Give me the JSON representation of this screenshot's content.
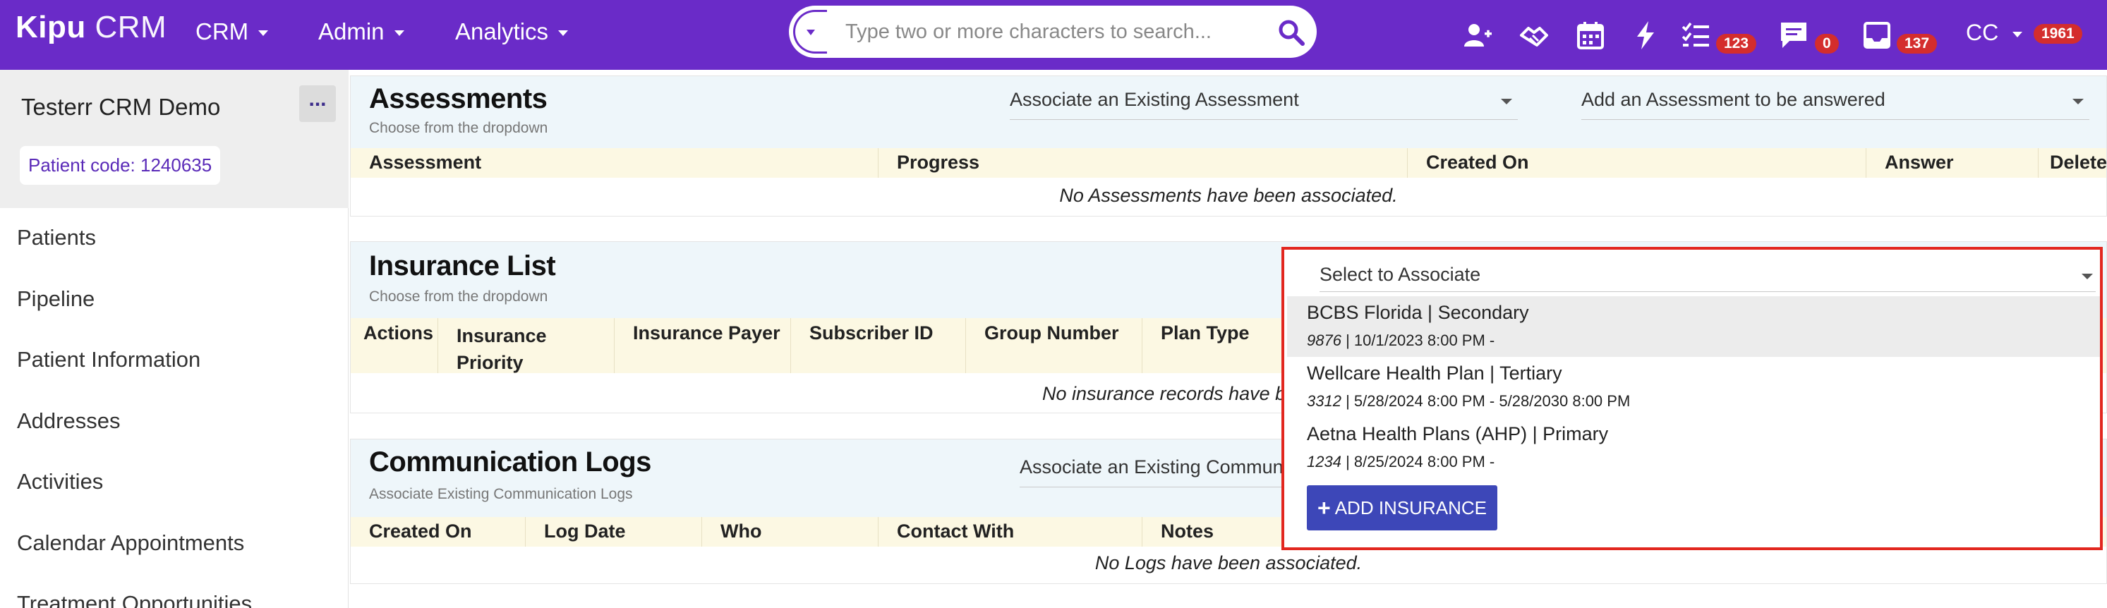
{
  "topbar": {
    "logo_bold": "Kipu",
    "logo_light": "CRM",
    "nav": [
      "CRM",
      "Admin",
      "Analytics"
    ],
    "search_placeholder": "Type two or more characters to search...",
    "icons": [
      "add-user-icon",
      "handshake-icon",
      "calendar-icon",
      "lightning-icon",
      "checklist-icon",
      "chat-icon",
      "inbox-icon"
    ],
    "badges": {
      "tasks": "123",
      "messages": "0",
      "inbox": "137",
      "user": "1961"
    },
    "user_initials": "CC",
    "colors": {
      "topbar": "#6a2bc8",
      "badge": "#d42d2d"
    }
  },
  "sidebar": {
    "title": "Testerr CRM Demo",
    "menu_dots": "...",
    "patient_code": "Patient code: 1240635",
    "items": [
      "Patients",
      "Pipeline",
      "Patient Information",
      "Addresses",
      "Activities",
      "Calendar Appointments",
      "Treatment Opportunities"
    ]
  },
  "assessments": {
    "title": "Assessments",
    "subtitle": "Choose from the dropdown",
    "select_existing": "Associate an Existing Assessment",
    "select_add": "Add an Assessment to be answered",
    "columns": [
      "Assessment",
      "Progress",
      "Created On",
      "Answer",
      "Delete"
    ],
    "empty": "No Assessments have been associated."
  },
  "insurance": {
    "title": "Insurance List",
    "subtitle": "Choose from the dropdown",
    "columns": [
      "Actions",
      "Insurance Priority",
      "Insurance Payer",
      "Subscriber ID",
      "Group Number",
      "Plan Type"
    ],
    "empty": "No insurance records have b"
  },
  "comm_logs": {
    "title": "Communication Logs",
    "subtitle": "Associate Existing Communication Logs",
    "select_existing": "Associate an Existing Commun",
    "columns": [
      "Created On",
      "Log Date",
      "Who",
      "Contact With",
      "Notes"
    ],
    "empty": "No Logs have been associated."
  },
  "dropdown": {
    "placeholder": "Select to Associate",
    "options": [
      {
        "label": "BCBS Florida | Secondary",
        "id": "9876",
        "dates": " | 10/1/2023 8:00 PM -"
      },
      {
        "label": "Wellcare Health Plan | Tertiary",
        "id": "3312",
        "dates": " | 5/28/2024 8:00 PM - 5/28/2030 8:00 PM"
      },
      {
        "label": "Aetna Health Plans (AHP) | Primary",
        "id": "1234",
        "dates": " | 8/25/2024 8:00 PM -"
      }
    ],
    "add_button": "ADD INSURANCE",
    "border_color": "#e2271f"
  }
}
